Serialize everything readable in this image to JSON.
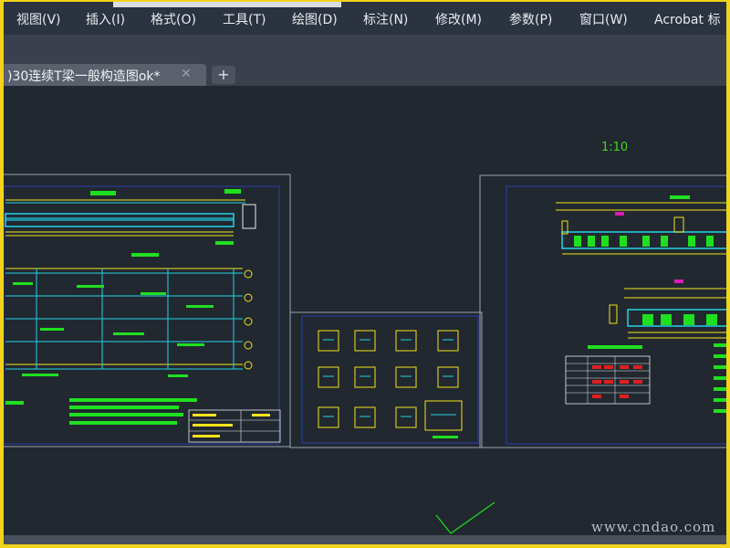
{
  "menu": {
    "items": [
      {
        "label": "视图(V)"
      },
      {
        "label": "插入(I)"
      },
      {
        "label": "格式(O)"
      },
      {
        "label": "工具(T)"
      },
      {
        "label": "绘图(D)"
      },
      {
        "label": "标注(N)"
      },
      {
        "label": "修改(M)"
      },
      {
        "label": "参数(P)"
      },
      {
        "label": "窗口(W)"
      },
      {
        "label": "Acrobat 标"
      }
    ]
  },
  "tabs": {
    "document_title": ")30连续T梁一般构造图ok*",
    "close_symbol": "✕",
    "new_tab_symbol": "+"
  },
  "drawing": {
    "scale_text": "1:10",
    "colors": {
      "background": "#212830",
      "sheet_border": "#9aa3b0",
      "inner_border": "#2c3fb0",
      "primary_line": "#22d3e6",
      "accent_line": "#f5e31c",
      "annotation": "#1fe01f",
      "highlight": "#e01ab8",
      "red_fill": "#e02020",
      "table_line": "#e8ecf0"
    }
  },
  "watermark": "www.cndao.com"
}
